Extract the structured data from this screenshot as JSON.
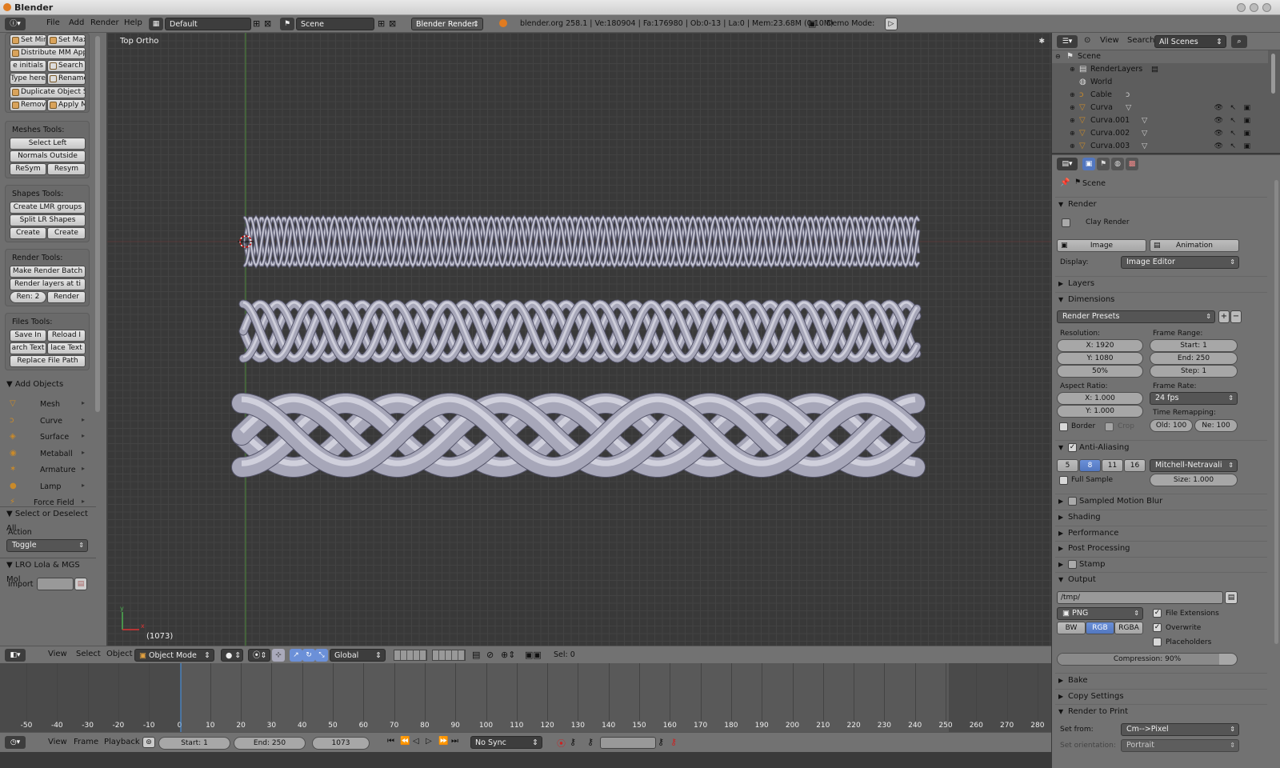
{
  "window": {
    "title": "Blender"
  },
  "topbar": {
    "menus": [
      "File",
      "Add",
      "Render",
      "Help"
    ],
    "screen_layout": "Default",
    "scene": "Scene",
    "engine": "Blender Render",
    "info": "blender.org 258.1 | Ve:180904 | Fa:176980 | Ob:0-13 | La:0 | Mem:23.68M (0.10M)",
    "demo_mode": "Demo Mode:"
  },
  "toolshelf": {
    "top_buttons": [
      "Set Min",
      "Set Max",
      "Distribute MM Appl",
      "e initials",
      "Search",
      "Type here",
      "Rename",
      "Duplicate Object Sy",
      "Remov",
      "Apply M"
    ],
    "meshes": {
      "title": "Meshes Tools:",
      "buttons": [
        "Select Left",
        "Normals Outside",
        "ReSym",
        "Resym"
      ]
    },
    "shapes": {
      "title": "Shapes Tools:",
      "buttons": [
        "Create LMR groups",
        "Split LR Shapes",
        "Create",
        "Create"
      ]
    },
    "render": {
      "title": "Render Tools:",
      "buttons": [
        "Make Render Batch",
        "Render layers at ti",
        "Ren: 2",
        "Render"
      ]
    },
    "files": {
      "title": "Files Tools:",
      "buttons": [
        "Save In",
        "Reload I",
        "arch Text",
        "lace Text",
        "Replace File Path"
      ]
    },
    "add_objects": {
      "title": "Add Objects",
      "items": [
        "Mesh",
        "Curve",
        "Surface",
        "Metaball",
        "Armature",
        "Lamp",
        "Force Field"
      ]
    },
    "select_panel": {
      "title": "Select or Deselect All",
      "action_label": "Action",
      "action_value": "Toggle"
    },
    "lro_panel": {
      "title": "LRO Lola & MGS Mol",
      "import_label": "Import"
    }
  },
  "viewport": {
    "view_name": "Top Ortho",
    "frame": "(1073)"
  },
  "viewport_header": {
    "menus": [
      "View",
      "Select",
      "Object"
    ],
    "mode": "Object Mode",
    "orientation": "Global",
    "selection": "Sel: 0"
  },
  "timeline": {
    "ticks": [
      "-50",
      "-40",
      "-30",
      "-20",
      "-10",
      "0",
      "10",
      "20",
      "30",
      "40",
      "50",
      "60",
      "70",
      "80",
      "90",
      "100",
      "110",
      "120",
      "130",
      "140",
      "150",
      "160",
      "170",
      "180",
      "190",
      "200",
      "210",
      "220",
      "230",
      "240",
      "250",
      "260",
      "270",
      "280"
    ],
    "menus": [
      "View",
      "Frame",
      "Playback"
    ],
    "start": "Start: 1",
    "end": "End: 250",
    "current": "1073",
    "sync": "No Sync"
  },
  "outliner": {
    "menus": [
      "View",
      "Search"
    ],
    "filter": "All Scenes",
    "items": [
      "Scene",
      "RenderLayers",
      "World",
      "Cable",
      "Curva",
      "Curva.001",
      "Curva.002",
      "Curva.003"
    ]
  },
  "properties": {
    "context": "Scene",
    "render_section": "Render",
    "clay_render": "Clay Render",
    "image_button": "Image",
    "animation_button": "Animation",
    "display_label": "Display:",
    "display_value": "Image Editor",
    "layers": "Layers",
    "dimensions": "Dimensions",
    "render_presets": "Render Presets",
    "resolution_label": "Resolution:",
    "res_x": "X: 1920",
    "res_y": "Y: 1080",
    "res_pct": "50%",
    "frame_range_label": "Frame Range:",
    "start": "Start: 1",
    "end": "End: 250",
    "step": "Step: 1",
    "aspect_label": "Aspect Ratio:",
    "aspect_x": "X: 1.000",
    "aspect_y": "Y: 1.000",
    "frame_rate_label": "Frame Rate:",
    "frame_rate": "24 fps",
    "border": "Border",
    "crop": "Crop",
    "time_remap_label": "Time Remapping:",
    "old": "Old: 100",
    "new": "Ne: 100",
    "anti_aliasing": "Anti-Aliasing",
    "aa_samples": [
      "5",
      "8",
      "11",
      "16"
    ],
    "aa_filter": "Mitchell-Netravali",
    "full_sample": "Full Sample",
    "size": "Size: 1.000",
    "sampled_motion_blur": "Sampled Motion Blur",
    "shading": "Shading",
    "performance": "Performance",
    "post_processing": "Post Processing",
    "stamp": "Stamp",
    "output": "Output",
    "output_path": "/tmp/",
    "file_format": "PNG",
    "file_extensions": "File Extensions",
    "overwrite": "Overwrite",
    "placeholders": "Placeholders",
    "color_modes": [
      "BW",
      "RGB",
      "RGBA"
    ],
    "compression": "Compression: 90%",
    "bake": "Bake",
    "copy_settings": "Copy Settings",
    "render_to_print": "Render to Print",
    "set_from_label": "Set from:",
    "set_from": "Cm-->Pixel",
    "set_orientation_label": "Set orientation:",
    "orientation": "Portrait"
  }
}
